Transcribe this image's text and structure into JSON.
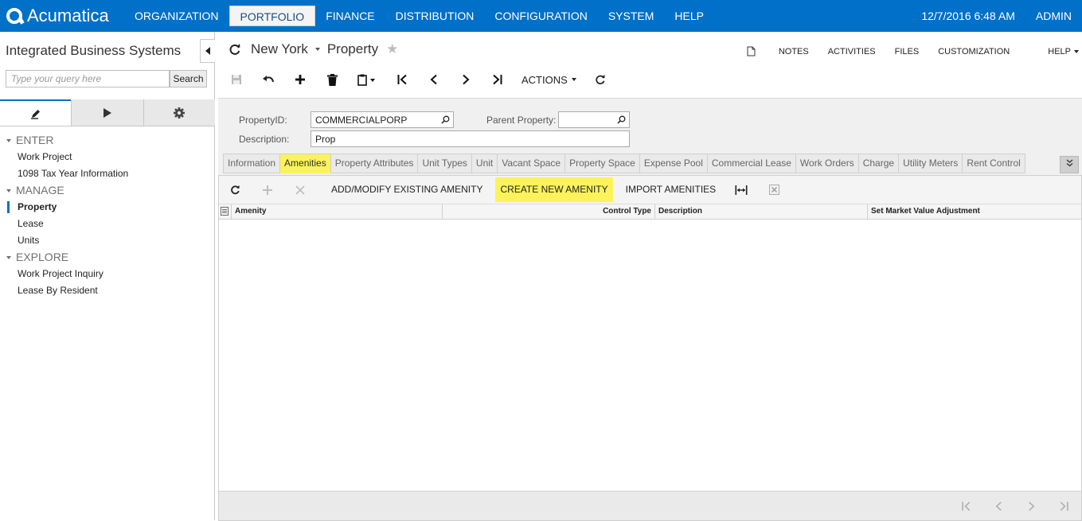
{
  "app": {
    "brand": "Acumatica"
  },
  "topnav": {
    "items": [
      "ORGANIZATION",
      "PORTFOLIO",
      "FINANCE",
      "DISTRIBUTION",
      "CONFIGURATION",
      "SYSTEM",
      "HELP"
    ],
    "active": "PORTFOLIO",
    "datetime": "12/7/2016  6:48 AM",
    "user": "ADMIN"
  },
  "sidebar": {
    "company": "Integrated Business Systems",
    "search": {
      "placeholder": "Type your query here",
      "button": "Search"
    },
    "groups": [
      {
        "label": "ENTER",
        "items": [
          "Work Project",
          "1098 Tax Year Information"
        ]
      },
      {
        "label": "MANAGE",
        "items": [
          "Property",
          "Lease",
          "Units"
        ]
      },
      {
        "label": "EXPLORE",
        "items": [
          "Work Project Inquiry",
          "Lease By Resident"
        ]
      }
    ],
    "selected": "Property"
  },
  "header": {
    "location": "New York",
    "screen": "Property",
    "links": [
      "NOTES",
      "ACTIVITIES",
      "FILES",
      "CUSTOMIZATION",
      "HELP"
    ],
    "actions_label": "ACTIONS"
  },
  "form": {
    "property_id_label": "PropertyID:",
    "property_id_value": "COMMERCIALPORP",
    "parent_property_label": "Parent Property:",
    "parent_property_value": "",
    "description_label": "Description:",
    "description_value": "Prop"
  },
  "tabs": {
    "items": [
      "Information",
      "Amenities",
      "Property Attributes",
      "Unit Types",
      "Unit",
      "Vacant Space",
      "Property Space",
      "Expense Pool",
      "Commercial Lease",
      "Work Orders",
      "Charge",
      "Utility Meters",
      "Rent Control"
    ],
    "active": "Amenities"
  },
  "grid": {
    "toolbar": {
      "add_modify_label": "ADD/MODIFY EXISTING AMENITY",
      "create_new_label": "CREATE NEW AMENITY",
      "import_label": "IMPORT AMENITIES"
    },
    "columns": [
      "Amenity",
      "Control Type",
      "Description",
      "Set Market Value Adjustment"
    ],
    "rows": []
  },
  "colors": {
    "brand_blue": "#0070c8",
    "highlight_yellow": "#fbf35b"
  }
}
